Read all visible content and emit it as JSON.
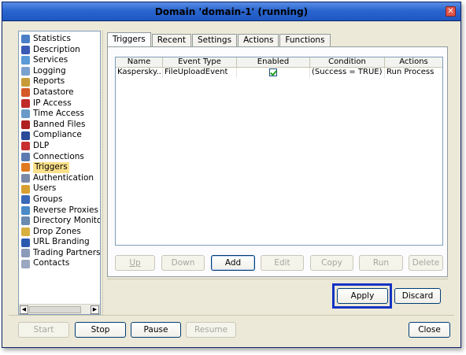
{
  "window": {
    "title": "Domain 'domain-1' (running)",
    "close_glyph": "✕"
  },
  "sidebar": {
    "items": [
      {
        "label": "Statistics",
        "icon": "statistics-icon",
        "color": "#4a7fc7"
      },
      {
        "label": "Description",
        "icon": "person-icon",
        "color": "#3a5bb5"
      },
      {
        "label": "Services",
        "icon": "services-icon",
        "color": "#5a9ad8"
      },
      {
        "label": "Logging",
        "icon": "logging-icon",
        "color": "#7aa0d0"
      },
      {
        "label": "Reports",
        "icon": "reports-icon",
        "color": "#c89b3a"
      },
      {
        "label": "Datastore",
        "icon": "datastore-icon",
        "color": "#d45a2a"
      },
      {
        "label": "IP Access",
        "icon": "ip-access-icon",
        "color": "#c02a2a"
      },
      {
        "label": "Time Access",
        "icon": "clock-icon",
        "color": "#6a9ac8"
      },
      {
        "label": "Banned Files",
        "icon": "banned-files-icon",
        "color": "#b02020"
      },
      {
        "label": "Compliance",
        "icon": "compliance-icon",
        "color": "#2a4a9a"
      },
      {
        "label": "DLP",
        "icon": "dlp-icon",
        "color": "#c83030"
      },
      {
        "label": "Connections",
        "icon": "connections-icon",
        "color": "#5a7ab0"
      },
      {
        "label": "Triggers",
        "icon": "triggers-icon",
        "color": "#e07a20"
      },
      {
        "label": "Authentication",
        "icon": "authentication-icon",
        "color": "#7a8aa8"
      },
      {
        "label": "Users",
        "icon": "users-icon",
        "color": "#d8a030"
      },
      {
        "label": "Groups",
        "icon": "groups-icon",
        "color": "#3a6ab8"
      },
      {
        "label": "Reverse Proxies",
        "icon": "reverse-proxies-icon",
        "color": "#4a8ac8"
      },
      {
        "label": "Directory Monitors",
        "icon": "directory-monitors-icon",
        "color": "#6a8ab0"
      },
      {
        "label": "Drop Zones",
        "icon": "drop-zones-icon",
        "color": "#d8b040"
      },
      {
        "label": "URL Branding",
        "icon": "url-branding-icon",
        "color": "#2a5ab0"
      },
      {
        "label": "Trading Partners",
        "icon": "trading-partners-icon",
        "color": "#8a9ab8"
      },
      {
        "label": "Contacts",
        "icon": "contacts-icon",
        "color": "#9aa8c0"
      }
    ],
    "active_index": 12,
    "scroll_left": "◀",
    "scroll_right": "▶"
  },
  "tabs": [
    {
      "label": "Triggers",
      "active": true
    },
    {
      "label": "Recent",
      "active": false
    },
    {
      "label": "Settings",
      "active": false
    },
    {
      "label": "Actions",
      "active": false
    },
    {
      "label": "Functions",
      "active": false
    }
  ],
  "table": {
    "columns": [
      "Name",
      "Event Type",
      "Enabled",
      "Condition",
      "Actions"
    ],
    "rows": [
      {
        "name": "Kaspersky...",
        "event_type": "FileUploadEvent",
        "enabled": true,
        "condition": "(Success = TRUE)",
        "actions": "Run Process"
      }
    ]
  },
  "table_buttons": {
    "up": "Up",
    "down": "Down",
    "add": "Add",
    "edit": "Edit",
    "copy": "Copy",
    "run": "Run",
    "delete": "Delete"
  },
  "dialog_buttons": {
    "apply": "Apply",
    "discard": "Discard"
  },
  "footer_buttons": {
    "start": "Start",
    "stop": "Stop",
    "pause": "Pause",
    "resume": "Resume",
    "close": "Close"
  }
}
